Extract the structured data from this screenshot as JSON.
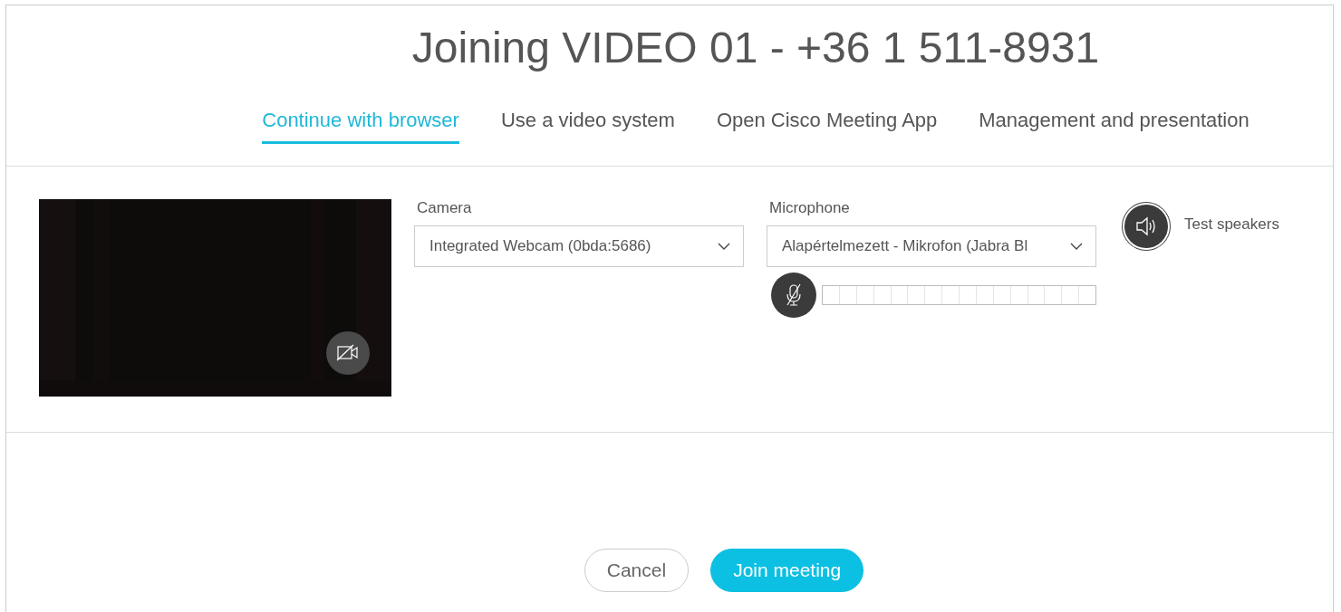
{
  "title": "Joining VIDEO 01 - +36 1 511-8931",
  "tabs": [
    {
      "label": "Continue with browser",
      "selected": true
    },
    {
      "label": "Use a video system",
      "selected": false
    },
    {
      "label": "Open Cisco Meeting App",
      "selected": false
    },
    {
      "label": "Management and presentation",
      "selected": false
    }
  ],
  "preview": {
    "camera_off": true
  },
  "camera": {
    "label": "Camera",
    "value": "Integrated Webcam (0bda:5686)"
  },
  "microphone": {
    "label": "Microphone",
    "value": "Alapértelmezett - Mikrofon (Jabra Bl",
    "muted": true
  },
  "speakers": {
    "label": "Test speakers"
  },
  "buttons": [
    {
      "label": "Cancel",
      "kind": "secondary"
    },
    {
      "label": "Join meeting",
      "kind": "primary"
    }
  ]
}
